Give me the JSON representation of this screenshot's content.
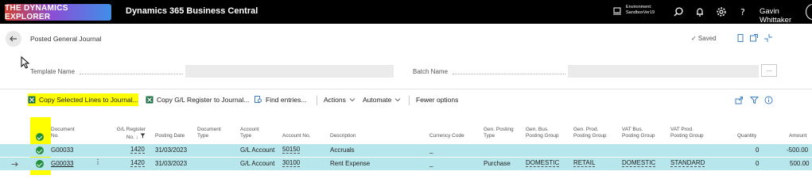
{
  "topbar": {
    "logo_text": "THE DYNAMICS EXPLORER",
    "product": "Dynamics 365 Business Central",
    "environment_label": "Environment:",
    "environment_value": "SandboxVer19",
    "user": "Gavin Whittaker"
  },
  "page": {
    "title": "Posted General Journal",
    "saved": "✓ Saved"
  },
  "fields": {
    "template_name_label": "Template Name",
    "template_name_value": "",
    "batch_name_label": "Batch Name",
    "batch_name_value": "",
    "more_label": "..."
  },
  "actions": {
    "copy_selected": "Copy Selected Lines to Journal...",
    "copy_register": "Copy G/L Register to Journal...",
    "find_entries": "Find entries...",
    "actions": "Actions",
    "automate": "Automate",
    "fewer_options": "Fewer options"
  },
  "columns": {
    "document_no": [
      "Document",
      "No."
    ],
    "gl_register": [
      "G/L Register",
      "No. ↓"
    ],
    "posting_date": [
      "Posting Date"
    ],
    "document_type": [
      "Document",
      "Type"
    ],
    "account_type": [
      "Account",
      "Type"
    ],
    "account_no": [
      "Account No."
    ],
    "description": [
      "Description"
    ],
    "currency_code": [
      "Currency Code"
    ],
    "gen_posting_type": [
      "Gen. Posting",
      "Type"
    ],
    "gen_bus_group": [
      "Gen. Bus.",
      "Posting Group"
    ],
    "gen_prod_group": [
      "Gen. Prod.",
      "Posting Group"
    ],
    "vat_bus_group": [
      "VAT Bus.",
      "Posting Group"
    ],
    "vat_prod_group": [
      "VAT Prod.",
      "Posting Group"
    ],
    "quantity": [
      "Quantity"
    ],
    "amount": [
      "Amount"
    ]
  },
  "rows": [
    {
      "document_no": "G00033",
      "gl_register": "1420",
      "posting_date": "31/03/2023",
      "document_type": "",
      "account_type": "G/L Account",
      "account_no": "50150",
      "description": "Accruals",
      "currency_code": "_",
      "gen_posting_type": "",
      "gen_bus_group": "",
      "gen_prod_group": "",
      "vat_bus_group": "",
      "vat_prod_group": "",
      "quantity": "0",
      "amount": "-500.00"
    },
    {
      "document_no": "G00033",
      "gl_register": "1420",
      "posting_date": "31/03/2023",
      "document_type": "",
      "account_type": "G/L Account",
      "account_no": "30100",
      "description": "Rent Expense",
      "currency_code": "_",
      "gen_posting_type": "Purchase",
      "gen_bus_group": "DOMESTIC",
      "gen_prod_group": "RETAIL",
      "vat_bus_group": "DOMESTIC",
      "vat_prod_group": "STANDARD",
      "quantity": "0",
      "amount": "500.00"
    }
  ],
  "colors": {
    "highlight": "#ffff00",
    "row_selected": "#b7e6ec",
    "check_green": "#21913b"
  }
}
